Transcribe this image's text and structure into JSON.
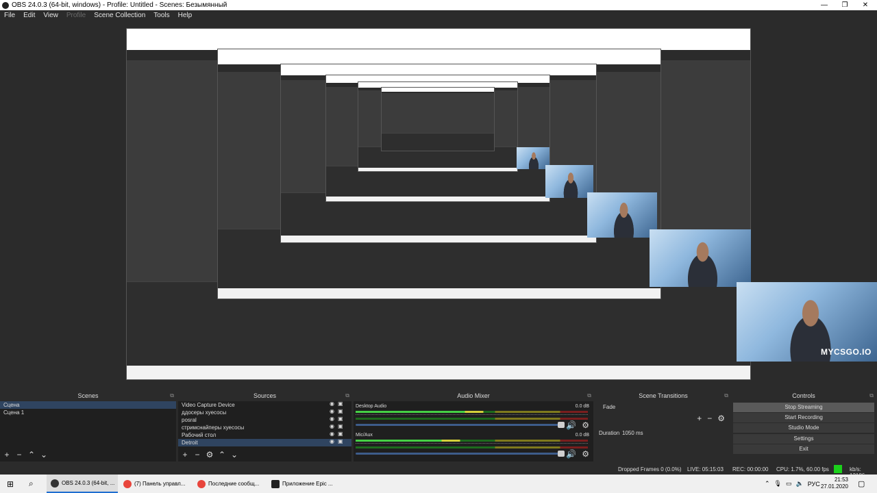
{
  "window": {
    "title": "OBS 24.0.3 (64-bit, windows) - Profile: Untitled - Scenes: Безымянный",
    "min": "—",
    "max": "❐",
    "close": "✕"
  },
  "menu": [
    "File",
    "Edit",
    "View",
    "Profile",
    "Scene Collection",
    "Tools",
    "Help"
  ],
  "preview": {
    "watermark": "MYCSGO.IO"
  },
  "scenes": {
    "title": "Scenes",
    "items": [
      "Сцена",
      "Сцена 1"
    ]
  },
  "sources": {
    "title": "Sources",
    "items": [
      "Video Capture Device",
      "ддосеры хуесосы",
      "posral",
      "стримснайперы хуесосы",
      "Рабочий стол",
      "Detroit"
    ]
  },
  "mixer": {
    "title": "Audio Mixer",
    "channels": [
      {
        "name": "Desktop Audio",
        "db": "0.0 dB",
        "level": 0.55
      },
      {
        "name": "Mic/Aux",
        "db": "0.0 dB",
        "level": 0.45
      }
    ]
  },
  "transitions": {
    "title": "Scene Transitions",
    "selected": "Fade",
    "duration_label": "Duration",
    "duration_value": "1050 ms"
  },
  "controls": {
    "title": "Controls",
    "buttons": [
      "Stop Streaming",
      "Start Recording",
      "Studio Mode",
      "Settings",
      "Exit"
    ]
  },
  "status": {
    "dropped": "Dropped Frames 0 (0.0%)",
    "live": "LIVE: 05:15:03",
    "rec": "REC: 00:00:00",
    "cpu": "CPU: 1.7%, 60.00 fps",
    "kbs": "kb/s: 13186"
  },
  "taskbar": {
    "tasks": [
      "OBS 24.0.3 (64-bit, ...",
      "(7) Панель управл...",
      "Последние сообщ...",
      "Приложение Epic ..."
    ],
    "lang": "РУС",
    "time": "21:53",
    "date": "27.01.2020"
  }
}
